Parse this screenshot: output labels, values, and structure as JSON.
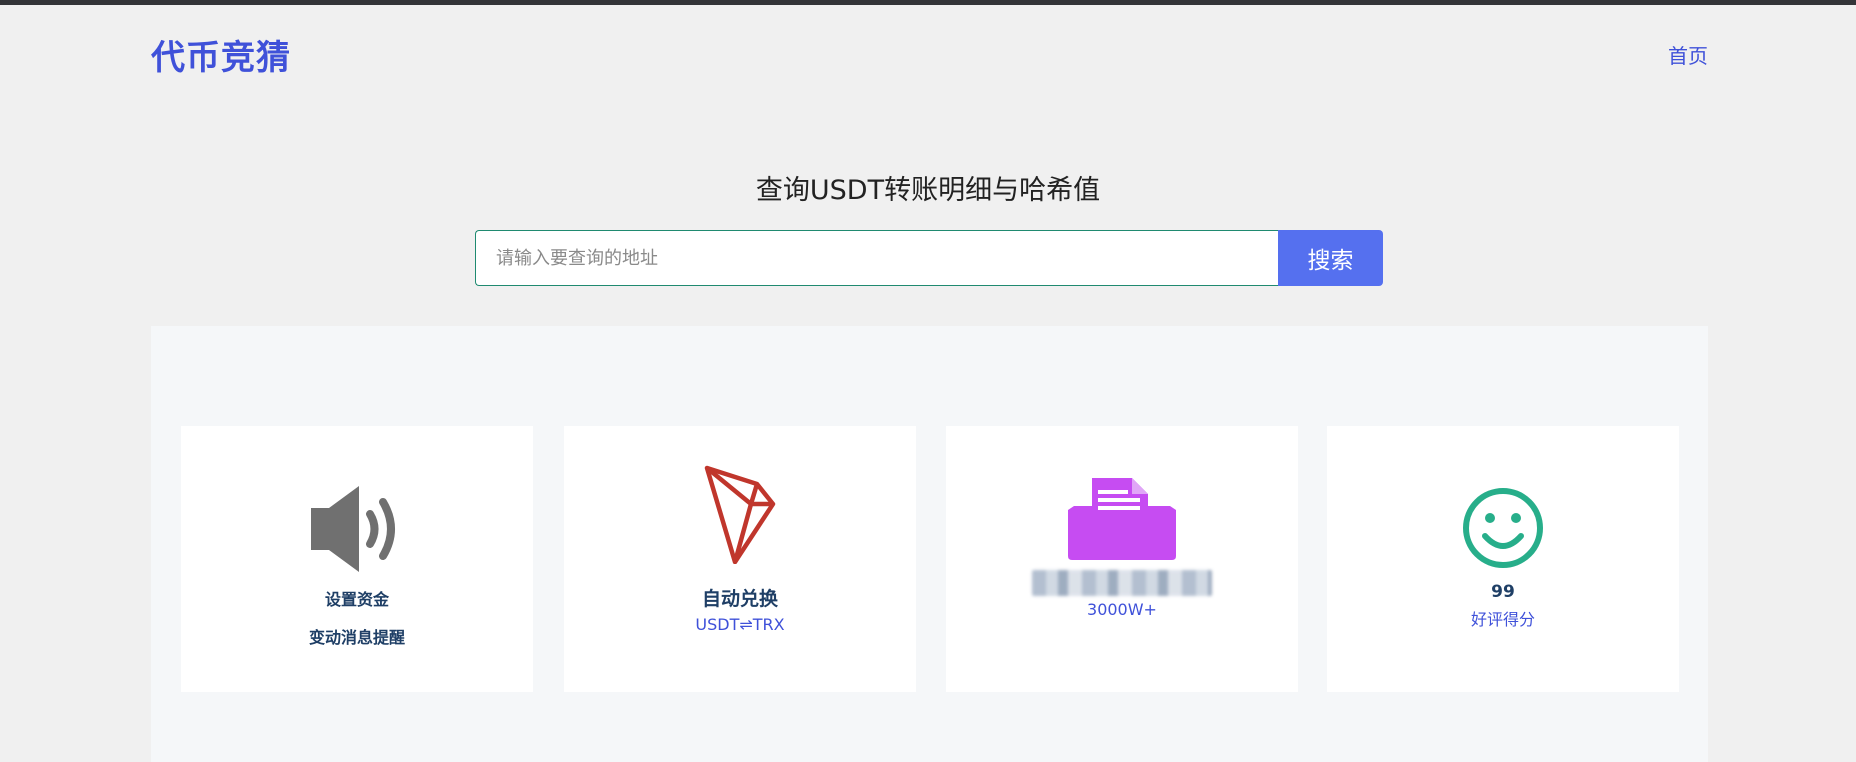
{
  "header": {
    "logo": "代币竞猜",
    "nav_home": "首页"
  },
  "hero": {
    "title": "查询USDT转账明细与哈希值",
    "search_placeholder": "请输入要查询的地址",
    "search_button": "搜索"
  },
  "features": [
    {
      "icon": "speaker-icon",
      "line1": "设置资金",
      "line2": "变动消息提醒",
      "color": "#707070"
    },
    {
      "icon": "tron-icon",
      "title": "自动兑换",
      "subtitle": "USDT⇌TRX",
      "color": "#c0362c"
    },
    {
      "icon": "printer-icon",
      "subtitle": "3000W+",
      "color": "#c64cf2"
    },
    {
      "icon": "smiley-icon",
      "value": "99",
      "subtitle": "好评得分",
      "color": "#27ae8a"
    }
  ],
  "colors": {
    "accent": "#3f51d9",
    "button": "#5570ef",
    "input_border": "#1f8a70"
  }
}
